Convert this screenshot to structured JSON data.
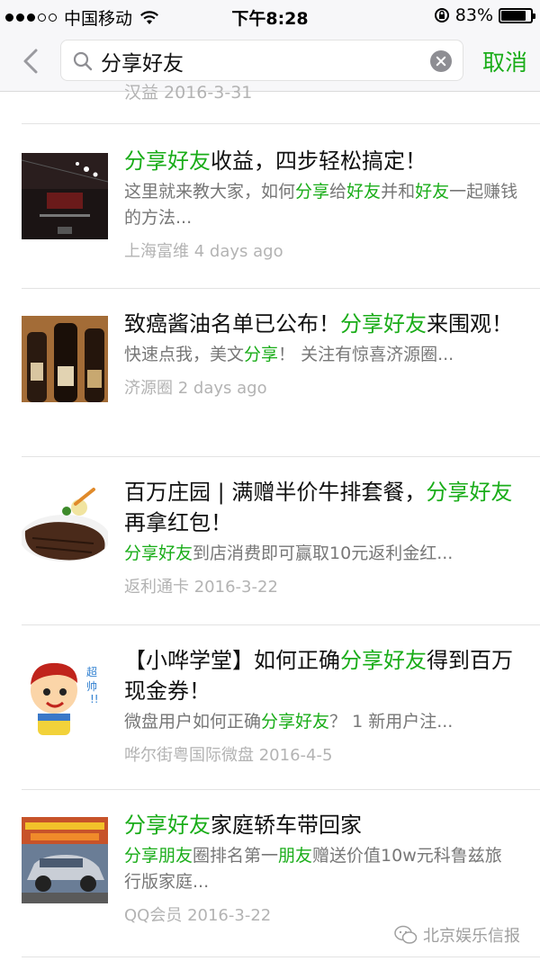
{
  "status_bar": {
    "carrier": "中国移动",
    "time": "下午8:28",
    "battery": "83%",
    "battery_level": 0.83
  },
  "search": {
    "query": "分享好友",
    "cancel_label": "取消"
  },
  "prev_fragment": "汉益 2016-3-31",
  "results": [
    {
      "title": [
        "分享好友",
        "收益，四步轻松搞定！"
      ],
      "desc": [
        "这里就来教大家，如何",
        "分享",
        "给",
        "好友",
        "并和",
        "好友",
        "一起赚钱的方法..."
      ],
      "source": "上海富维",
      "time": "4 days ago"
    },
    {
      "title": [
        "致癌酱油名单已公布！",
        "分享好友",
        "来围观！"
      ],
      "desc": [
        "快速点我，美文",
        "分享",
        "！ 关注有惊喜济源圈..."
      ],
      "source": "济源圈",
      "time": "2 days ago"
    },
    {
      "title": [
        "百万庄园 | 满赠半价牛排套餐，",
        "分享好友",
        "再拿红包！"
      ],
      "desc": [
        "分享好友",
        "到店消费即可赢取10元返利金红..."
      ],
      "source": "返利通卡",
      "time": "2016-3-22"
    },
    {
      "title": [
        "【小哗学堂】如何正确",
        "分享好友",
        "得到百万现金券！"
      ],
      "desc": [
        "微盘用户如何正确",
        "分享好友",
        "？ 1 新用户注..."
      ],
      "source": "哗尔街粤国际微盘",
      "time": "2016-4-5"
    },
    {
      "title": [
        "分享好友",
        "家庭轿车带回家"
      ],
      "desc": [
        "分享朋友",
        "圈排名第一",
        "朋友",
        "赠送价值10w元科鲁兹旅行版家庭..."
      ],
      "source": "QQ会员",
      "time": "2016-3-22"
    }
  ],
  "watermark": "北京娱乐信报",
  "colors": {
    "accent": "#1aad19",
    "muted": "#b3b3b3",
    "desc": "#777777"
  }
}
